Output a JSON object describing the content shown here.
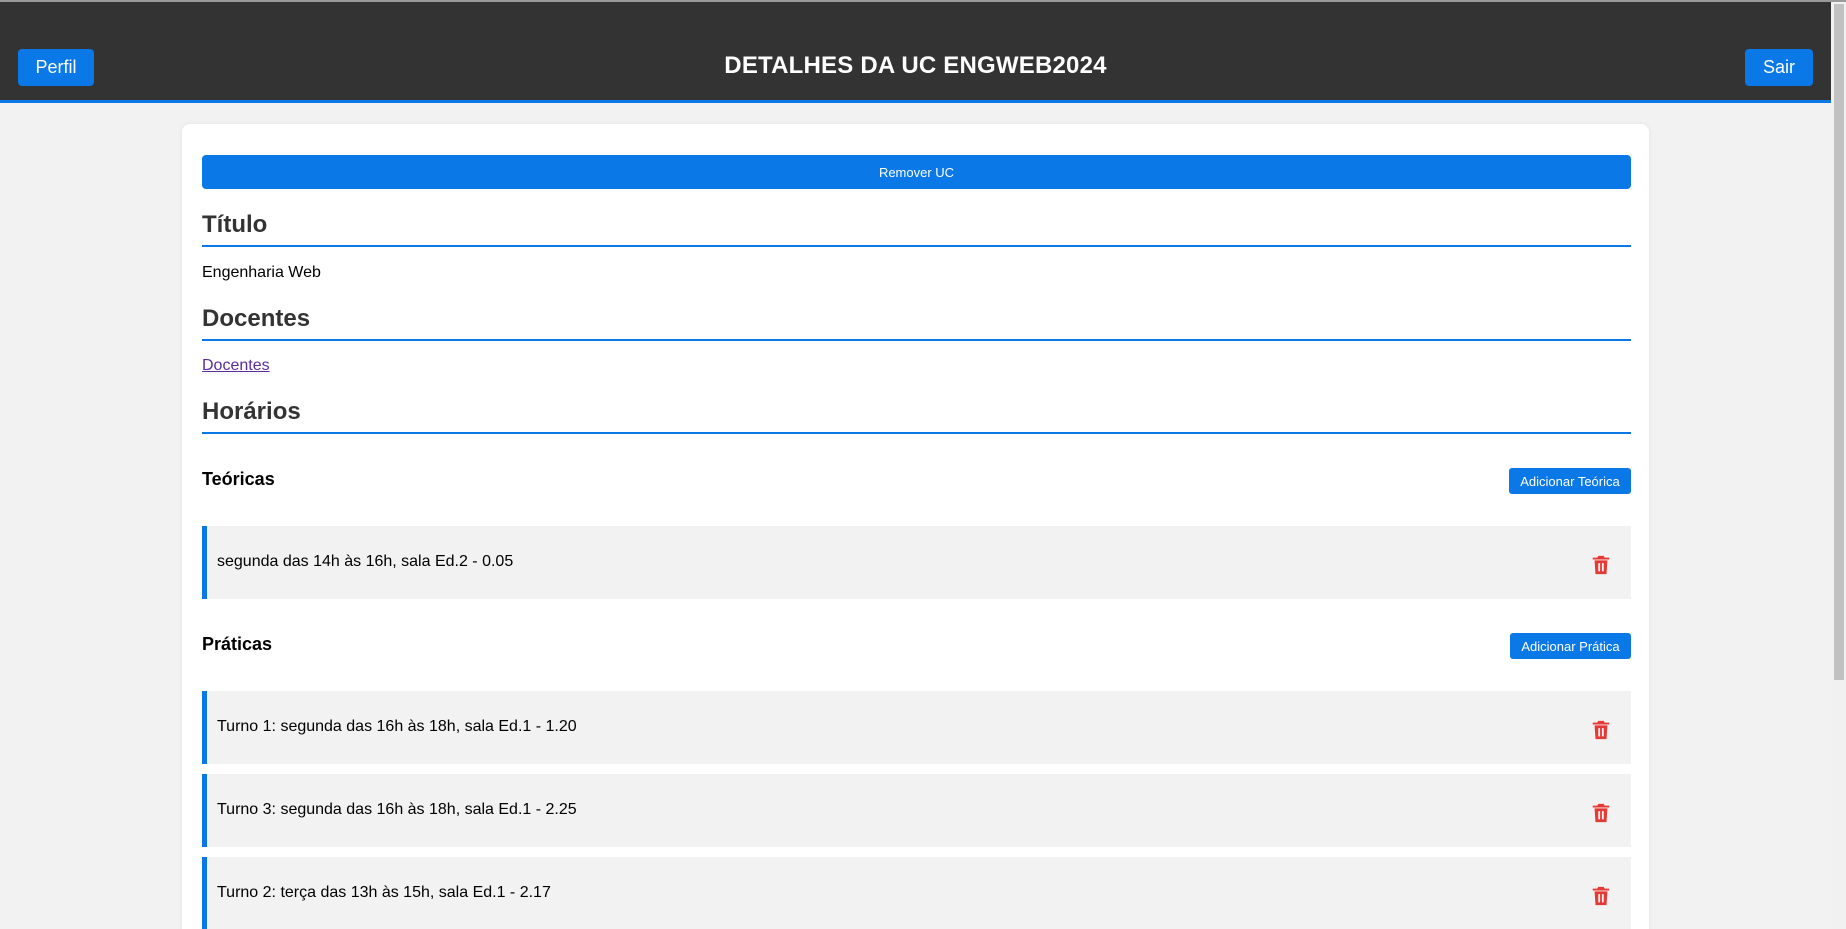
{
  "header": {
    "title": "DETALHES DA UC ENGWEB2024",
    "profile_label": "Perfil",
    "logout_label": "Sair"
  },
  "main": {
    "remove_label": "Remover UC",
    "titulo": {
      "heading": "Título",
      "value": "Engenharia Web"
    },
    "docentes": {
      "heading": "Docentes",
      "link": "Docentes"
    },
    "horarios": {
      "heading": "Horários",
      "teoricas": {
        "heading": "Teóricas",
        "add_label": "Adicionar Teórica",
        "items": [
          "segunda das 14h às 16h, sala Ed.2 - 0.05"
        ]
      },
      "praticas": {
        "heading": "Práticas",
        "add_label": "Adicionar Prática",
        "items": [
          "Turno 1: segunda das 16h às 18h, sala Ed.1 - 1.20",
          "Turno 3: segunda das 16h às 18h, sala Ed.1 - 2.25",
          "Turno 2: terça das 13h às 15h, sala Ed.1 - 2.17"
        ]
      }
    }
  },
  "icons": {
    "delete": "trash-icon"
  },
  "colors": {
    "accent": "#0a78e6",
    "header_bg": "#333333",
    "delete": "#e53935"
  }
}
